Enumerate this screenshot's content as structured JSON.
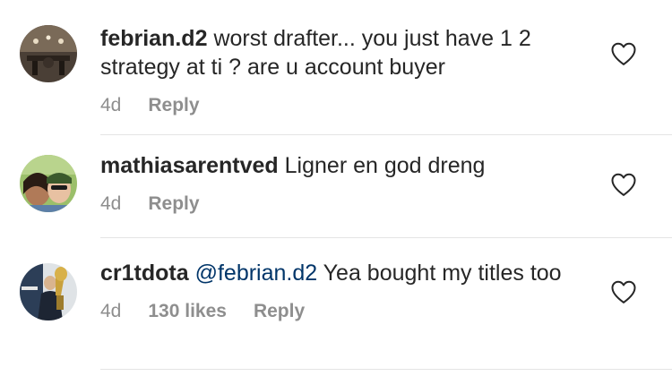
{
  "comments": [
    {
      "username": "febrian.d2",
      "mention": "",
      "text": "worst drafter... you just have 1 2 strategy at ti ? are u account buyer",
      "time": "4d",
      "likes": "",
      "reply_label": "Reply"
    },
    {
      "username": "mathiasarentved",
      "mention": "",
      "text": "Ligner en god dreng",
      "time": "4d",
      "likes": "",
      "reply_label": "Reply"
    },
    {
      "username": "cr1tdota",
      "mention": "@febrian.d2",
      "text": "Yea bought my titles too",
      "time": "4d",
      "likes": "130 likes",
      "reply_label": "Reply"
    }
  ],
  "icons": {
    "like": "heart-outline-icon"
  },
  "colors": {
    "text": "#262626",
    "secondary": "#8e8e8e",
    "mention": "#003569",
    "divider": "#e4e4e4"
  }
}
